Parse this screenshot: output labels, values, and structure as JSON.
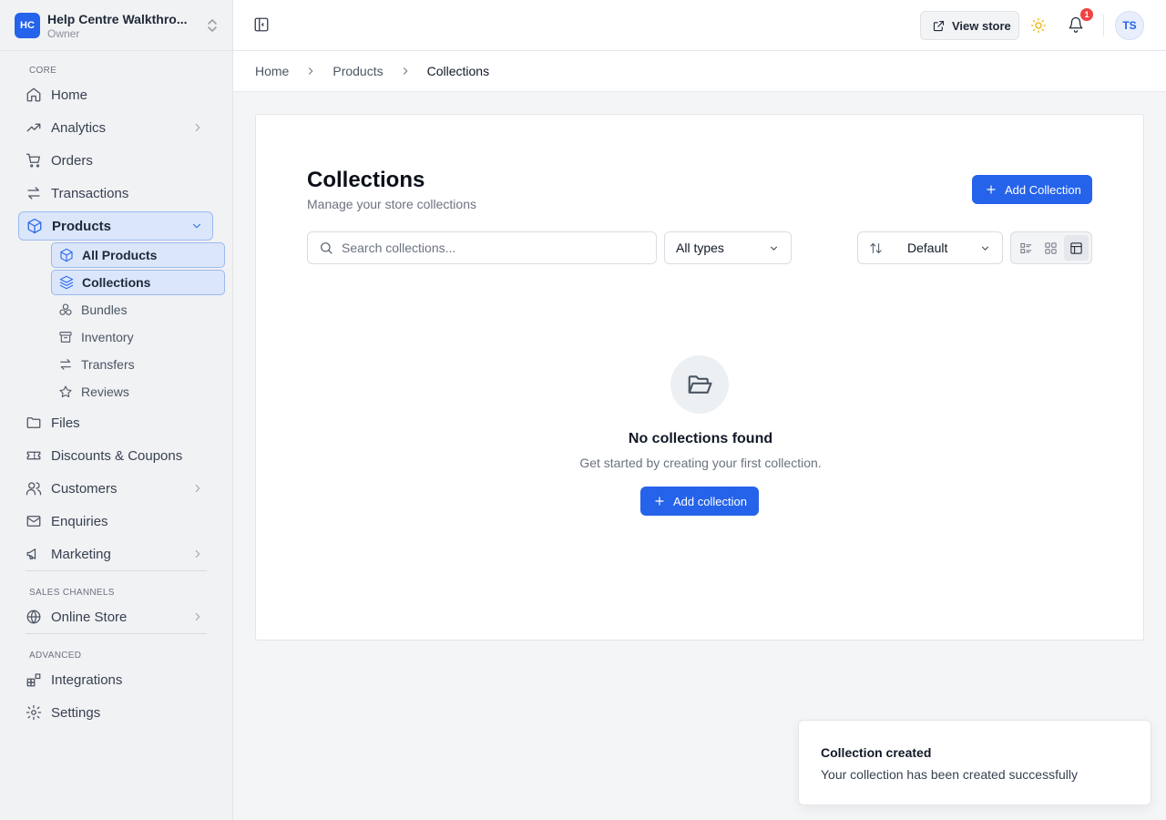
{
  "org": {
    "initials": "HC",
    "name": "Help Centre Walkthro...",
    "role": "Owner"
  },
  "sidebar": {
    "sections": {
      "core": "CORE",
      "sales_channels": "SALES CHANNELS",
      "advanced": "ADVANCED"
    },
    "items": [
      {
        "label": "Home",
        "icon": "home-icon"
      },
      {
        "label": "Analytics",
        "icon": "trending-up-icon"
      },
      {
        "label": "Orders",
        "icon": "cart-icon"
      },
      {
        "label": "Transactions",
        "icon": "arrows-icon"
      },
      {
        "label": "Products",
        "icon": "box-icon",
        "expanded": true
      },
      {
        "label": "Files",
        "icon": "folder-icon"
      },
      {
        "label": "Discounts & Coupons",
        "icon": "ticket-icon"
      },
      {
        "label": "Customers",
        "icon": "users-icon"
      },
      {
        "label": "Enquiries",
        "icon": "mail-icon"
      },
      {
        "label": "Marketing",
        "icon": "megaphone-icon"
      },
      {
        "label": "Online Store",
        "icon": "globe-icon"
      },
      {
        "label": "Integrations",
        "icon": "blocks-icon"
      },
      {
        "label": "Settings",
        "icon": "gear-icon"
      }
    ],
    "product_subitems": [
      {
        "label": "All Products",
        "icon": "box-icon"
      },
      {
        "label": "Collections",
        "icon": "layers-icon"
      },
      {
        "label": "Bundles",
        "icon": "boxes-icon"
      },
      {
        "label": "Inventory",
        "icon": "archive-icon"
      },
      {
        "label": "Transfers",
        "icon": "arrows-icon"
      },
      {
        "label": "Reviews",
        "icon": "star-icon"
      }
    ]
  },
  "topbar": {
    "view_store": "View store",
    "notification_count": "1",
    "avatar_initials": "TS"
  },
  "breadcrumb": [
    "Home",
    "Products",
    "Collections"
  ],
  "main": {
    "title": "Collections",
    "subtitle": "Manage your store collections",
    "add_button": "Add Collection",
    "search_placeholder": "Search collections...",
    "type_filter": "All types",
    "sort": "Default",
    "empty": {
      "title": "No collections found",
      "text": "Get started by creating your first collection.",
      "button": "Add collection"
    }
  },
  "toast": {
    "title": "Collection created",
    "message": "Your collection has been created successfully"
  },
  "colors": {
    "accent": "#2563eb",
    "active_bg": "#dbe6fb",
    "badge": "#ef4444"
  }
}
